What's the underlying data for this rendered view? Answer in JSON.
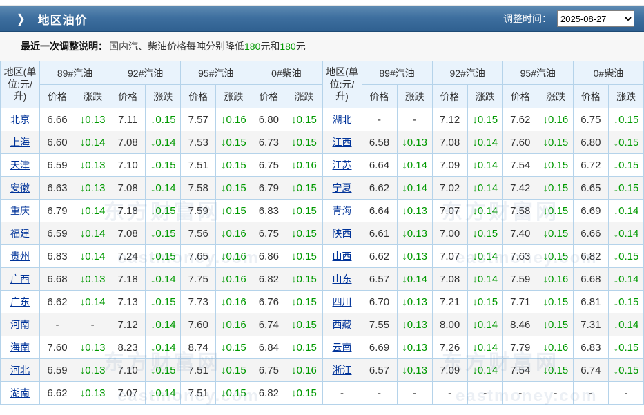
{
  "header": {
    "title": "地区油价",
    "chevron": "❯",
    "date_label": "调整时间：",
    "date_value": "2025-08-27"
  },
  "notice": {
    "label": "最近一次调整说明：",
    "segments": [
      {
        "text": "国内汽、柴油价格每吨分别降低",
        "green": false
      },
      {
        "text": "180",
        "green": true
      },
      {
        "text": "元和",
        "green": false
      },
      {
        "text": "180",
        "green": true
      },
      {
        "text": "元",
        "green": false
      }
    ]
  },
  "colors": {
    "bar_blue": "#3e6f9f",
    "table_border": "#b5d3ea",
    "header_bg": "#e9f3fc",
    "even_row_bg": "#f4f4f4",
    "link_blue": "#003399",
    "change_green": "#009900",
    "value_gray": "#333333"
  },
  "watermark": {
    "text_cn": "东方财富网",
    "text_en": "eastmoney.com"
  },
  "table": {
    "region_header": "地区(单位:元/升)",
    "product_headers": [
      "89#汽油",
      "92#汽油",
      "95#汽油",
      "0#柴油"
    ],
    "sub_headers": [
      "价格",
      "涨跌"
    ],
    "left_rows": [
      {
        "region": "北京",
        "cells": [
          "6.66",
          "↓0.13",
          "7.11",
          "↓0.15",
          "7.57",
          "↓0.16",
          "6.80",
          "↓0.15"
        ]
      },
      {
        "region": "上海",
        "cells": [
          "6.60",
          "↓0.14",
          "7.08",
          "↓0.14",
          "7.53",
          "↓0.15",
          "6.73",
          "↓0.15"
        ]
      },
      {
        "region": "天津",
        "cells": [
          "6.59",
          "↓0.13",
          "7.10",
          "↓0.15",
          "7.51",
          "↓0.15",
          "6.75",
          "↓0.16"
        ]
      },
      {
        "region": "安徽",
        "cells": [
          "6.63",
          "↓0.13",
          "7.08",
          "↓0.14",
          "7.58",
          "↓0.15",
          "6.79",
          "↓0.15"
        ]
      },
      {
        "region": "重庆",
        "cells": [
          "6.79",
          "↓0.14",
          "7.18",
          "↓0.15",
          "7.59",
          "↓0.15",
          "6.83",
          "↓0.15"
        ]
      },
      {
        "region": "福建",
        "cells": [
          "6.59",
          "↓0.14",
          "7.08",
          "↓0.15",
          "7.56",
          "↓0.16",
          "6.75",
          "↓0.15"
        ]
      },
      {
        "region": "贵州",
        "cells": [
          "6.83",
          "↓0.14",
          "7.24",
          "↓0.15",
          "7.65",
          "↓0.16",
          "6.86",
          "↓0.15"
        ]
      },
      {
        "region": "广西",
        "cells": [
          "6.68",
          "↓0.13",
          "7.18",
          "↓0.14",
          "7.75",
          "↓0.16",
          "6.82",
          "↓0.15"
        ]
      },
      {
        "region": "广东",
        "cells": [
          "6.62",
          "↓0.14",
          "7.13",
          "↓0.15",
          "7.73",
          "↓0.16",
          "6.76",
          "↓0.15"
        ]
      },
      {
        "region": "河南",
        "cells": [
          "-",
          "-",
          "7.12",
          "↓0.14",
          "7.60",
          "↓0.16",
          "6.74",
          "↓0.15"
        ]
      },
      {
        "region": "海南",
        "cells": [
          "7.60",
          "↓0.13",
          "8.23",
          "↓0.14",
          "8.74",
          "↓0.15",
          "6.84",
          "↓0.15"
        ]
      },
      {
        "region": "河北",
        "cells": [
          "6.59",
          "↓0.13",
          "7.10",
          "↓0.15",
          "7.51",
          "↓0.15",
          "6.75",
          "↓0.16"
        ]
      },
      {
        "region": "湖南",
        "cells": [
          "6.62",
          "↓0.13",
          "7.07",
          "↓0.14",
          "7.51",
          "↓0.15",
          "6.82",
          "↓0.15"
        ]
      }
    ],
    "right_rows": [
      {
        "region": "湖北",
        "cells": [
          "-",
          "-",
          "7.12",
          "↓0.15",
          "7.62",
          "↓0.16",
          "6.75",
          "↓0.15"
        ]
      },
      {
        "region": "江西",
        "cells": [
          "6.58",
          "↓0.13",
          "7.08",
          "↓0.14",
          "7.60",
          "↓0.15",
          "6.80",
          "↓0.15"
        ]
      },
      {
        "region": "江苏",
        "cells": [
          "6.64",
          "↓0.14",
          "7.09",
          "↓0.14",
          "7.54",
          "↓0.15",
          "6.72",
          "↓0.15"
        ]
      },
      {
        "region": "宁夏",
        "cells": [
          "6.62",
          "↓0.14",
          "7.02",
          "↓0.14",
          "7.42",
          "↓0.15",
          "6.65",
          "↓0.15"
        ]
      },
      {
        "region": "青海",
        "cells": [
          "6.64",
          "↓0.13",
          "7.07",
          "↓0.14",
          "7.58",
          "↓0.15",
          "6.69",
          "↓0.14"
        ]
      },
      {
        "region": "陕西",
        "cells": [
          "6.61",
          "↓0.13",
          "7.00",
          "↓0.15",
          "7.40",
          "↓0.15",
          "6.66",
          "↓0.14"
        ]
      },
      {
        "region": "山西",
        "cells": [
          "6.62",
          "↓0.13",
          "7.07",
          "↓0.14",
          "7.63",
          "↓0.15",
          "6.82",
          "↓0.15"
        ]
      },
      {
        "region": "山东",
        "cells": [
          "6.57",
          "↓0.14",
          "7.08",
          "↓0.14",
          "7.59",
          "↓0.16",
          "6.68",
          "↓0.14"
        ]
      },
      {
        "region": "四川",
        "cells": [
          "6.70",
          "↓0.13",
          "7.21",
          "↓0.15",
          "7.71",
          "↓0.15",
          "6.81",
          "↓0.15"
        ]
      },
      {
        "region": "西藏",
        "cells": [
          "7.55",
          "↓0.13",
          "8.00",
          "↓0.14",
          "8.46",
          "↓0.15",
          "7.31",
          "↓0.14"
        ]
      },
      {
        "region": "云南",
        "cells": [
          "6.69",
          "↓0.13",
          "7.26",
          "↓0.14",
          "7.79",
          "↓0.16",
          "6.83",
          "↓0.15"
        ]
      },
      {
        "region": "浙江",
        "cells": [
          "6.57",
          "↓0.13",
          "7.09",
          "↓0.14",
          "7.54",
          "↓0.15",
          "6.74",
          "↓0.15"
        ]
      },
      {
        "region": "-",
        "cells": [
          "-",
          "-",
          "-",
          "-",
          "-",
          "-",
          "-",
          "-"
        ]
      }
    ]
  }
}
